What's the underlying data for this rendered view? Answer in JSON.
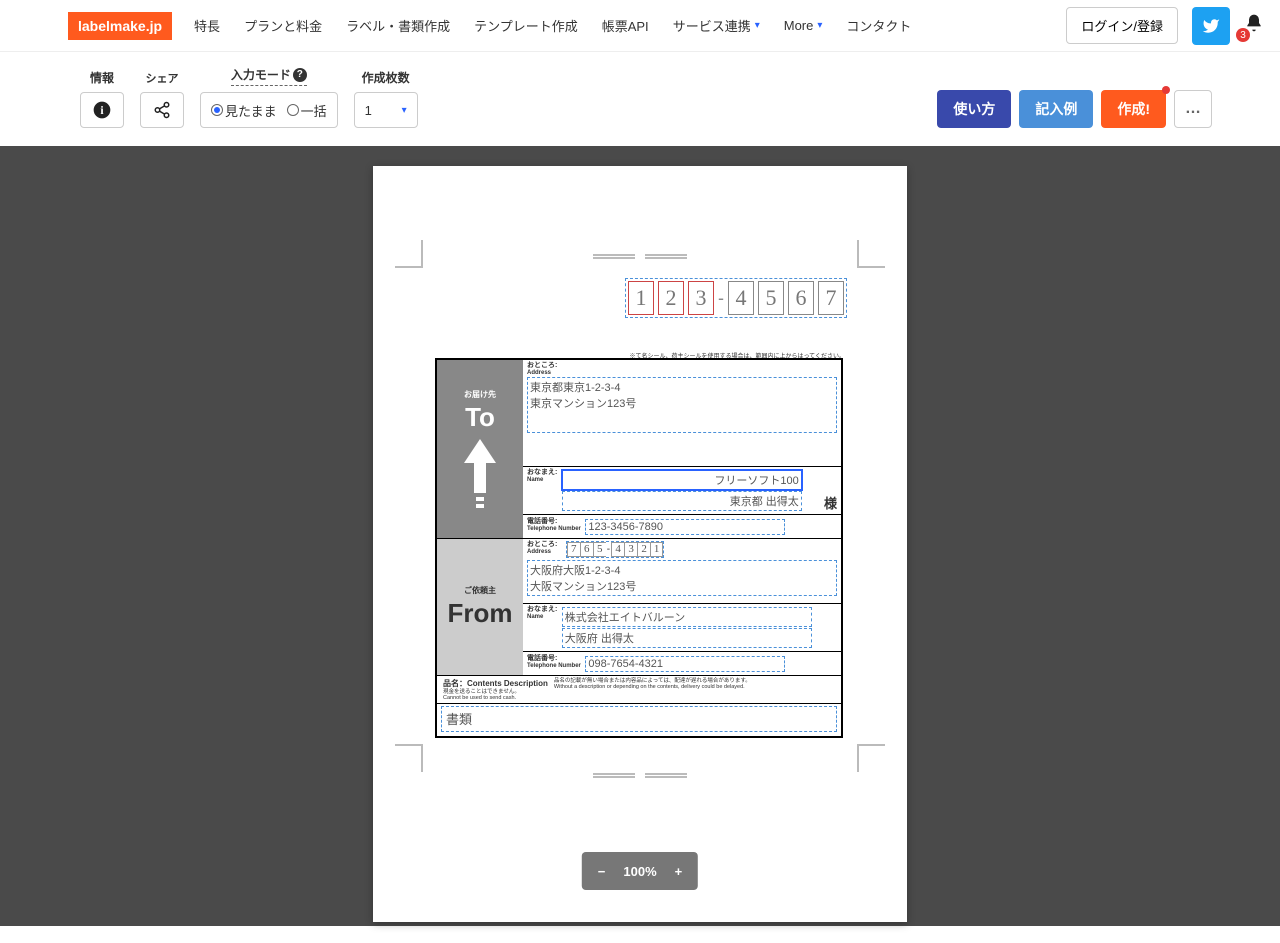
{
  "header": {
    "logo": "labelmake.jp",
    "nav": [
      "特長",
      "プランと料金",
      "ラベル・書類作成",
      "テンプレート作成",
      "帳票API",
      "サービス連携",
      "More",
      "コンタクト"
    ],
    "login": "ログイン/登録",
    "badge": "3"
  },
  "toolbar": {
    "labels": {
      "info": "情報",
      "share": "シェア",
      "mode": "入力モード",
      "count": "作成枚数"
    },
    "mode": {
      "visual": "見たまま",
      "bulk": "一括"
    },
    "count": "1",
    "buttons": {
      "howto": "使い方",
      "example": "記入例",
      "create": "作成!"
    }
  },
  "postal": [
    "1",
    "2",
    "3",
    "4",
    "5",
    "6",
    "7"
  ],
  "form": {
    "note": "※て名シール、荷主シールを使用する場合は、範囲内に上からはってください。",
    "to": {
      "sideSub": "お届け先",
      "sideMain": "To",
      "addressLabel": "おところ:",
      "addressSub": "Address",
      "address1": "東京都東京1-2-3-4",
      "address2": "東京マンション123号",
      "nameLabel": "おなまえ:",
      "nameSub": "Name",
      "company": "フリーソフト100",
      "name": "東京都 出得太",
      "sama": "様",
      "telLabel": "電話番号:",
      "telSub": "Telephone Number",
      "tel": "123-3456-7890"
    },
    "from": {
      "sideSub": "ご依頼主",
      "sideMain": "From",
      "addressLabel": "おところ:",
      "addressSub": "Address",
      "postal": [
        "7",
        "6",
        "5",
        "4",
        "3",
        "2",
        "1"
      ],
      "address1": "大阪府大阪1-2-3-4",
      "address2": "大阪マンション123号",
      "nameLabel": "おなまえ:",
      "nameSub": "Name",
      "company": "株式会社エイトバルーン",
      "name": "大阪府 出得太",
      "telLabel": "電話番号:",
      "telSub": "Telephone Number",
      "tel": "098-7654-4321"
    },
    "contents": {
      "label": "品名：Contents Description",
      "note1": "品名の記載が無い場合または内容品によっては、配達が遅れる場合があります。",
      "note1en": "Without a description or depending on the contents, delivery could be delayed.",
      "note2": "現金を送ることはできません。",
      "note2en": "Cannot be used to send cash.",
      "value": "書類"
    }
  },
  "zoom": "100%"
}
